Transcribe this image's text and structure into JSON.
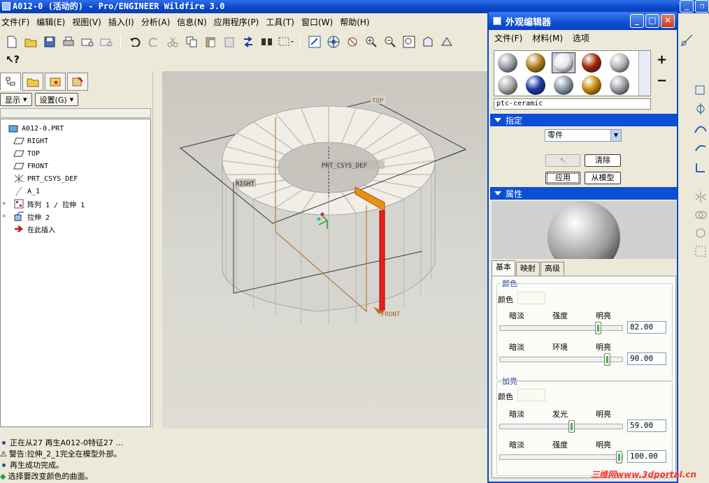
{
  "window": {
    "title": "A012-0 (活动的) - Pro/ENGINEER Wildfire 3.0"
  },
  "menu": [
    "文件(F)",
    "编辑(E)",
    "视图(V)",
    "插入(I)",
    "分析(A)",
    "信息(N)",
    "应用程序(P)",
    "工具(T)",
    "窗口(W)",
    "帮助(H)"
  ],
  "left_panel": {
    "show_button": "显示",
    "settings_button": "设置(G)",
    "tree": [
      {
        "label": "A012-0.PRT",
        "icon": "part-icon",
        "expand": ""
      },
      {
        "label": "RIGHT",
        "icon": "datum-plane-icon",
        "expand": ""
      },
      {
        "label": "TOP",
        "icon": "datum-plane-icon",
        "expand": ""
      },
      {
        "label": "FRONT",
        "icon": "datum-plane-icon",
        "expand": ""
      },
      {
        "label": "PRT_CSYS_DEF",
        "icon": "csys-icon",
        "expand": ""
      },
      {
        "label": "A_1",
        "icon": "axis-icon",
        "expand": ""
      },
      {
        "label": "阵列 1 / 拉伸 1",
        "icon": "pattern-icon",
        "expand": "+"
      },
      {
        "label": "拉伸 2",
        "icon": "extrude-icon",
        "expand": "+"
      },
      {
        "label": "在此插入",
        "icon": "insert-arrow-icon",
        "expand": ""
      }
    ]
  },
  "viewport": {
    "labels": {
      "top": "TOP",
      "right": "RIGHT",
      "front": "FRONT",
      "csys": "PRT_CSYS_DEF"
    }
  },
  "messages": [
    {
      "type": "info",
      "text": "正在从27 再生A012-0特征27 ..."
    },
    {
      "type": "warning",
      "text": "警告:拉伸_2_1完全在模型外部。"
    },
    {
      "type": "info",
      "text": "再生成功完成。"
    },
    {
      "type": "prompt",
      "text": "选择要改变颜色的曲面。"
    }
  ],
  "editor": {
    "title": "外观编辑器",
    "menu": [
      "文件(F)",
      "材料(M)",
      "选项"
    ],
    "material_name": "ptc-ceramic",
    "swatches": [
      "#9aa0a8",
      "#b0801a",
      "#e8e8e8",
      "#a02808",
      "#b8b8b8",
      "#a8a8a8",
      "#1838a8",
      "#8898a8",
      "#c88808",
      "#9ca0a4"
    ],
    "selected_swatch": 2,
    "assign_section": {
      "header": "指定",
      "target_select": "零件",
      "clear_button": "清除",
      "apply_button": "应用",
      "from_model_button": "从模型"
    },
    "properties_section": {
      "header": "属性",
      "tabs": [
        "基本",
        "映射",
        "高级"
      ],
      "active_tab": 0,
      "color_group": {
        "title": "颜色",
        "color_label": "颜色",
        "intensity": {
          "left": "暗淡",
          "mid": "强度",
          "right": "明亮",
          "value": "82.00",
          "fraction": 0.82
        },
        "ambient": {
          "left": "暗淡",
          "mid": "环境",
          "right": "明亮",
          "value": "90.00",
          "fraction": 0.9
        }
      },
      "highlight_group": {
        "title": "加亮",
        "color_label": "颜色",
        "shininess": {
          "left": "暗淡",
          "mid": "发光",
          "right": "明亮",
          "value": "59.00",
          "fraction": 0.59
        },
        "highlight_intensity": {
          "left": "暗淡",
          "mid": "强度",
          "right": "明亮",
          "value": "100.00",
          "fraction": 1.0
        }
      }
    }
  },
  "watermark": "三维网www.3dportal.cn"
}
